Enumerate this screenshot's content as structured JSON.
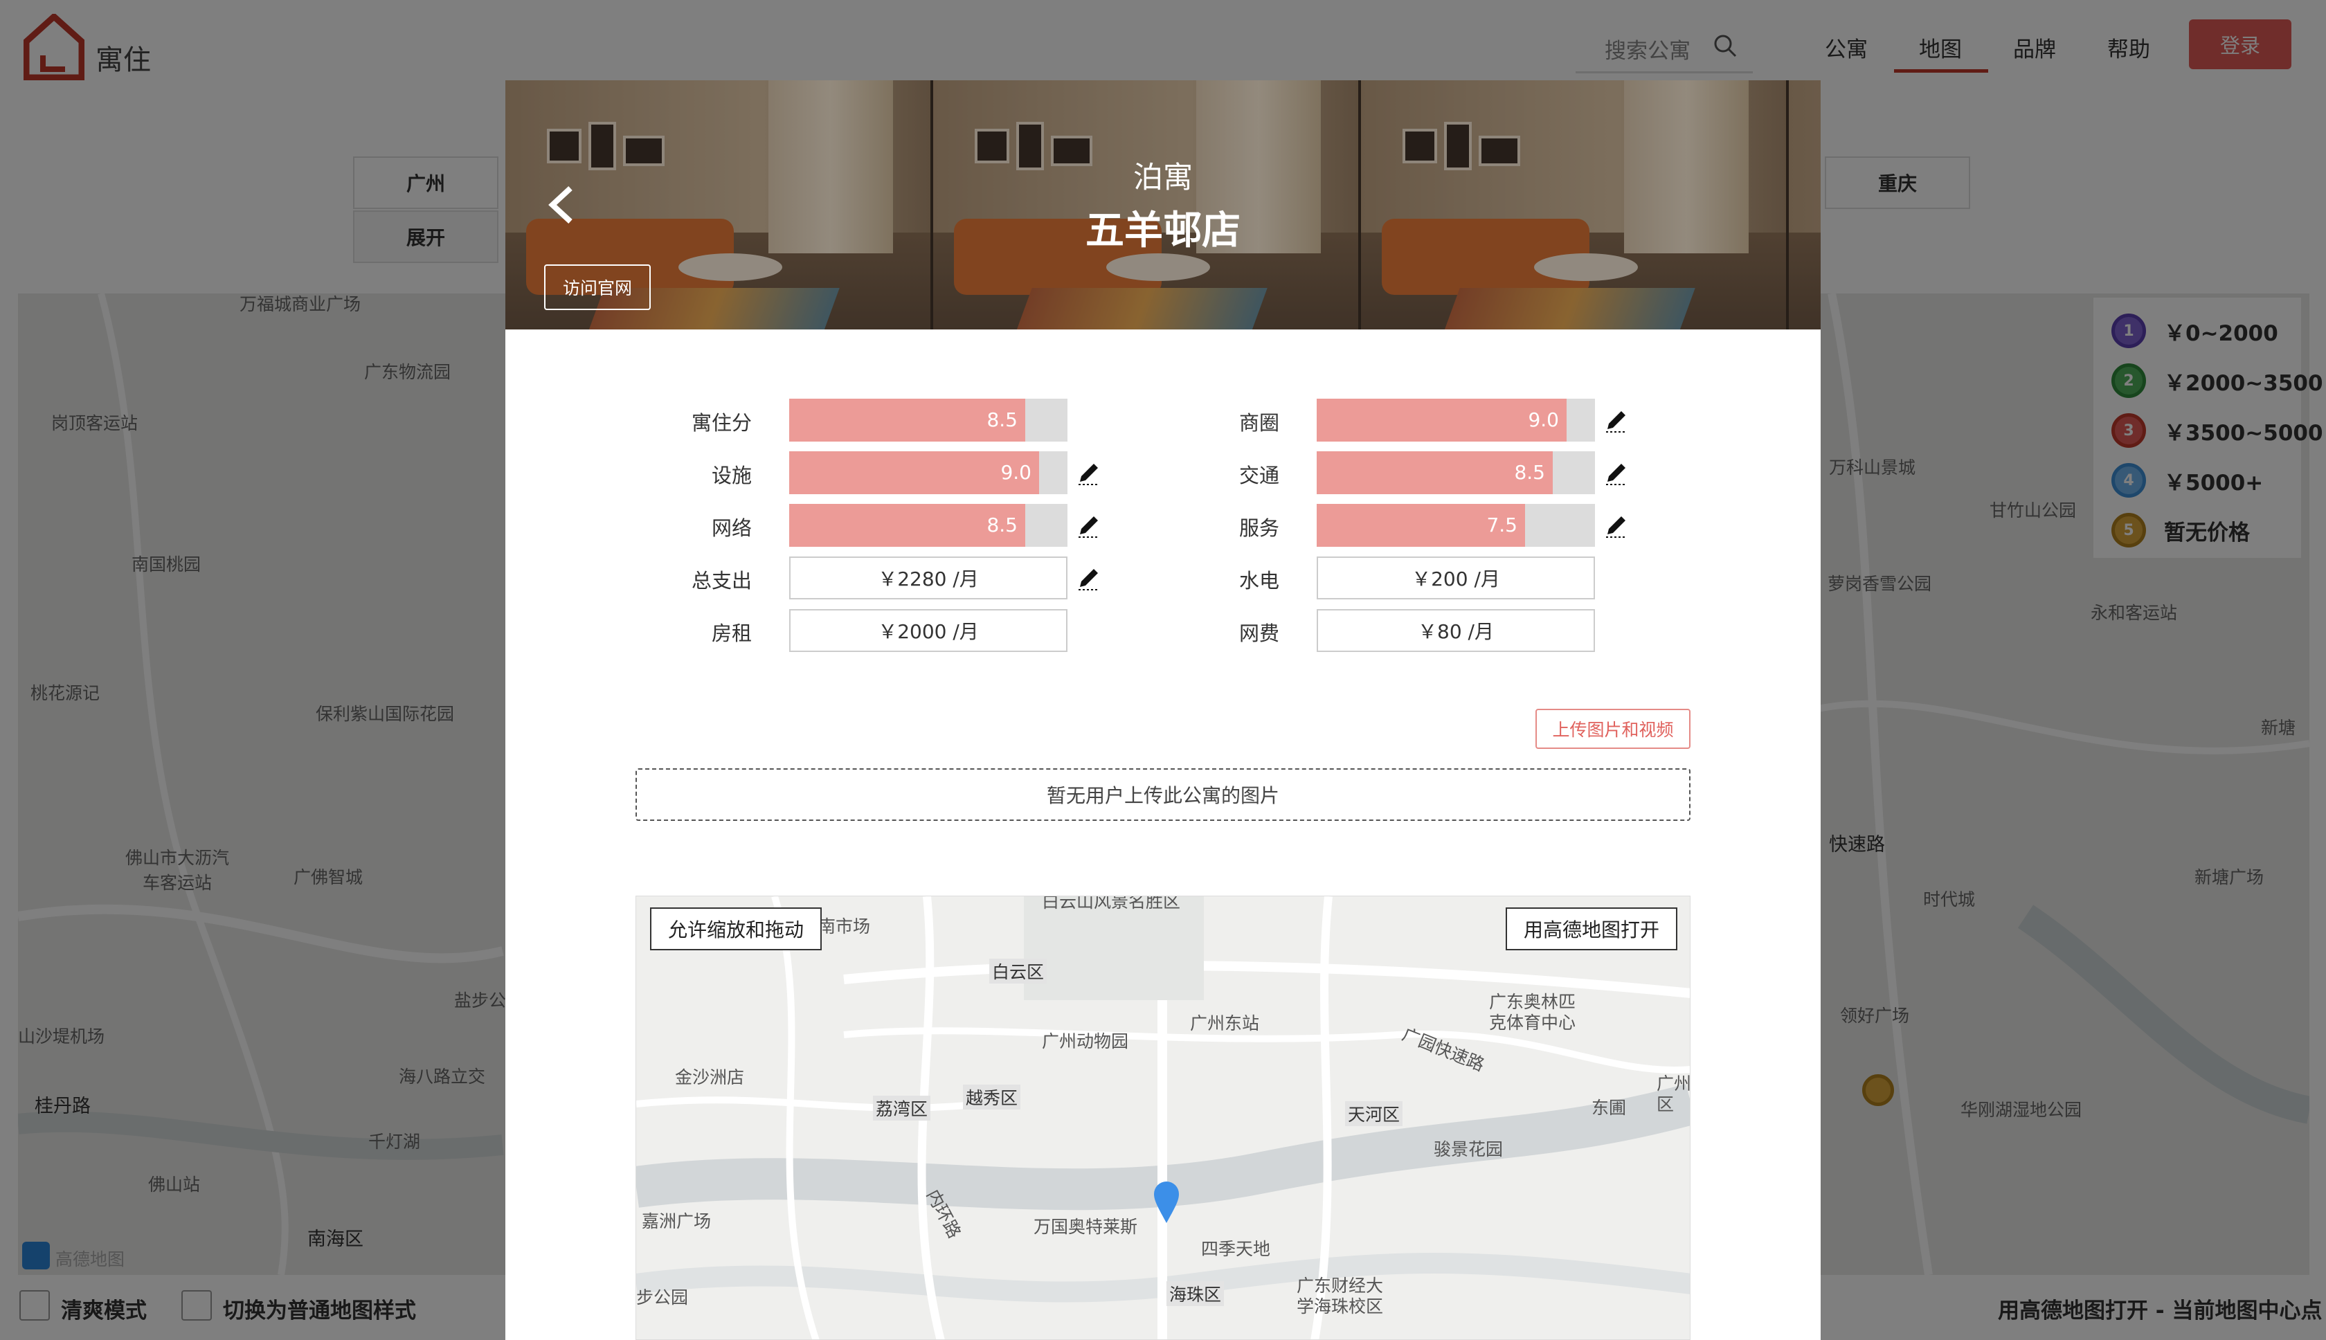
{
  "header": {
    "logo_text": "寓住",
    "search_placeholder": "搜索公寓",
    "nav": [
      "公寓",
      "地图",
      "品牌",
      "帮助"
    ],
    "login": "登录"
  },
  "city_tabs": {
    "left": "广州",
    "expand": "展开",
    "right": "重庆"
  },
  "legend": [
    {
      "label": "￥0~2000",
      "num": "1",
      "color": "#5b3fb0"
    },
    {
      "label": "￥2000~3500",
      "num": "2",
      "color": "#2f8a3a"
    },
    {
      "label": "￥3500~5000",
      "num": "3",
      "color": "#c0392b"
    },
    {
      "label": "￥5000+",
      "num": "4",
      "color": "#3c8fd6"
    },
    {
      "label": "暂无价格",
      "num": "5",
      "color": "#b0811d"
    }
  ],
  "bg_map_labels": [
    "万福城商业广场",
    "广东物流园",
    "岗顶客运站",
    "南国桃园",
    "桃花源记",
    "保利紫山国际花园",
    "佛山市大沥汽车客运站",
    "广佛智城",
    "山沙堤机场",
    "桂丹路",
    "海八路立交",
    "千灯湖",
    "佛山站",
    "南海区",
    "盐步公",
    "万科山景城",
    "甘竹山公园",
    "萝岗香雪公园",
    "永和客运站",
    "新塘",
    "快速路",
    "时代城",
    "新塘广场",
    "领好广场",
    "华刚湖湿地公园",
    "高德地图"
  ],
  "footer": {
    "mode": "清爽模式",
    "style": "切换为普通地图样式",
    "open": "用高德地图打开 - 当前地图中心点"
  },
  "modal": {
    "brand": "泊寓",
    "store": "五羊邨店",
    "visit": "访问官网",
    "scores_left": [
      {
        "label": "寓住分",
        "value": 8.5,
        "editable": false
      },
      {
        "label": "设施",
        "value": 9.0,
        "editable": true
      },
      {
        "label": "网络",
        "value": 8.5,
        "editable": true
      }
    ],
    "scores_right": [
      {
        "label": "商圈",
        "value": 9.0,
        "editable": true
      },
      {
        "label": "交通",
        "value": 8.5,
        "editable": true
      },
      {
        "label": "服务",
        "value": 7.5,
        "editable": true
      }
    ],
    "costs_left": [
      {
        "label": "总支出",
        "value": "￥2280 /月",
        "editable": true
      },
      {
        "label": "房租",
        "value": "￥2000 /月",
        "editable": false
      }
    ],
    "costs_right": [
      {
        "label": "水电",
        "value": "￥200 /月"
      },
      {
        "label": "网费",
        "value": "￥80 /月"
      }
    ],
    "upload": "上传图片和视频",
    "no_images": "暂无用户上传此公寓的图片",
    "map": {
      "zoom_btn": "允许缩放和拖动",
      "open_btn": "用高德地图打开",
      "labels": [
        "白云山风景名胜区",
        "江南市场",
        "广州动物园",
        "广州东站",
        "广东奥林匹克体育中心",
        "金沙洲店",
        "嘉洲广场",
        "万国奥特莱斯",
        "四季天地",
        "骏景花园",
        "广东财经大学海珠校区",
        "步公园",
        "广州区",
        "东圃",
        "广园快速路",
        "内环路"
      ],
      "districts": [
        "白云区",
        "荔湾区",
        "越秀区",
        "天河区",
        "海珠区"
      ]
    }
  },
  "colors": {
    "accent": "#e05a56",
    "bar": "#ec9b97",
    "pin": "#3c8fe8"
  }
}
